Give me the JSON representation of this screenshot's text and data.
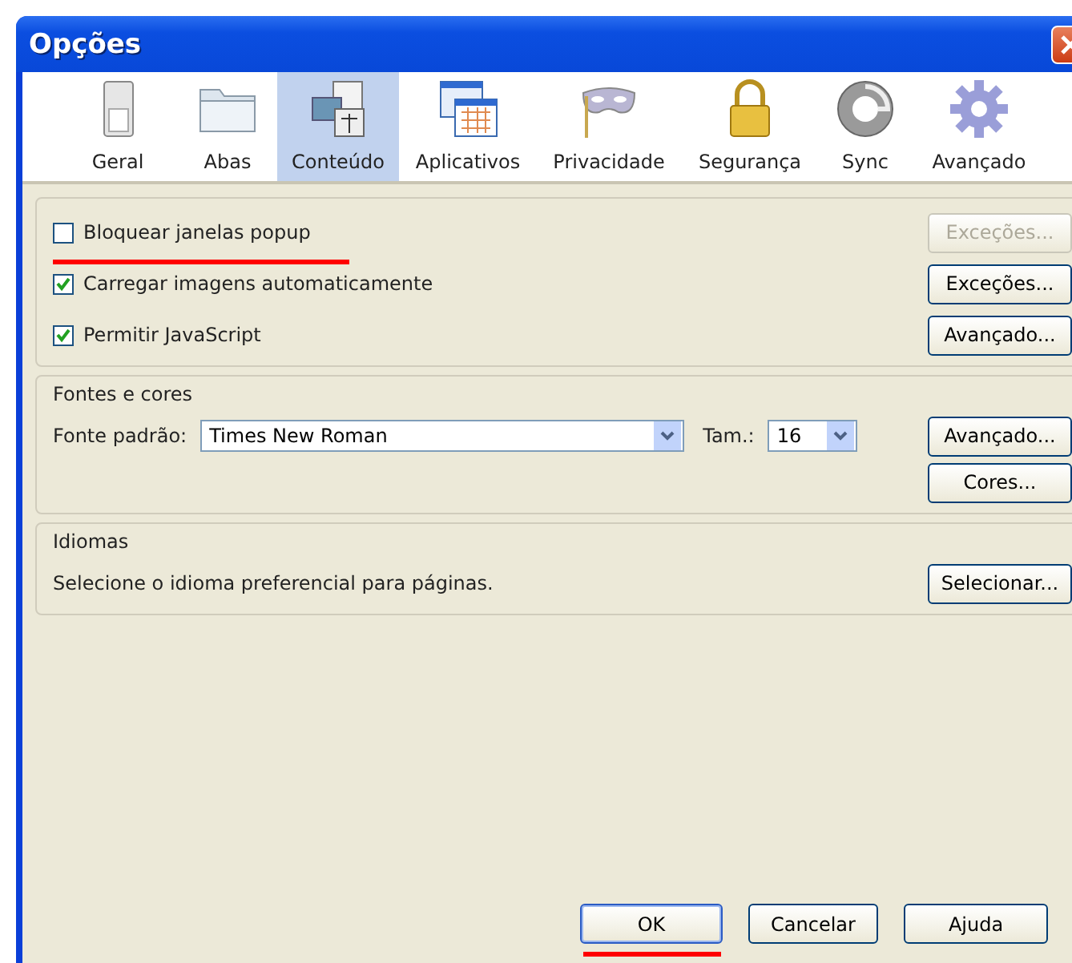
{
  "window": {
    "title": "Opções"
  },
  "tabs": [
    {
      "label": "Geral",
      "selected": false
    },
    {
      "label": "Abas",
      "selected": false
    },
    {
      "label": "Conteúdo",
      "selected": true
    },
    {
      "label": "Aplicativos",
      "selected": false
    },
    {
      "label": "Privacidade",
      "selected": false
    },
    {
      "label": "Segurança",
      "selected": false
    },
    {
      "label": "Sync",
      "selected": false
    },
    {
      "label": "Avançado",
      "selected": false
    }
  ],
  "options": [
    {
      "label": "Bloquear janelas popup",
      "checked": false,
      "underlined": true,
      "button": {
        "label": "Exceções...",
        "disabled": true
      }
    },
    {
      "label": "Carregar imagens automaticamente",
      "checked": true,
      "underlined": false,
      "button": {
        "label": "Exceções...",
        "disabled": false
      }
    },
    {
      "label": "Permitir JavaScript",
      "checked": true,
      "underlined": false,
      "button": {
        "label": "Avançado...",
        "disabled": false
      }
    }
  ],
  "fonts": {
    "title": "Fontes e cores",
    "font_label": "Fonte padrão:",
    "font_value": "Times New Roman",
    "size_label": "Tam.:",
    "size_value": "16",
    "buttons": [
      "Avançado...",
      "Cores..."
    ]
  },
  "languages": {
    "title": "Idiomas",
    "text": "Selecione o idioma preferencial para páginas.",
    "button": "Selecionar..."
  },
  "footer": [
    {
      "label": "OK",
      "default": true,
      "underlined": true
    },
    {
      "label": "Cancelar",
      "default": false,
      "underlined": false
    },
    {
      "label": "Ajuda",
      "default": false,
      "underlined": false
    }
  ]
}
